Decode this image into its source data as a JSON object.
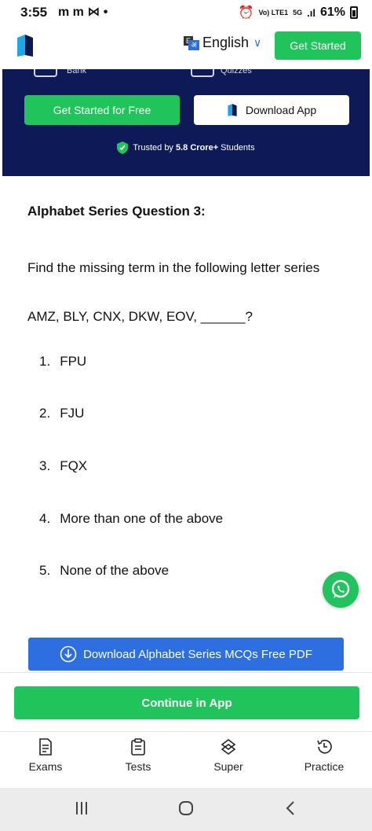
{
  "status_bar": {
    "time": "3:55",
    "notif_icons": [
      "m",
      "m",
      "mail",
      "•"
    ],
    "network": "Vo) LTE1",
    "signal": "5G",
    "battery": "61%"
  },
  "header": {
    "language": "English",
    "get_started": "Get Started"
  },
  "banner": {
    "chip_left": "Bank",
    "chip_right": "Quizzes",
    "get_started_free": "Get Started for Free",
    "download_app": "Download App",
    "trusted_prefix": "Trusted by ",
    "trusted_count": "5.8 Crore+",
    "trusted_suffix": " Students"
  },
  "question": {
    "title": "Alphabet Series Question 3:",
    "text": "Find the missing term in the following letter series",
    "series": "AMZ, BLY, CNX, DKW, EOV, ______?",
    "options": [
      {
        "num": "1.",
        "text": "FPU"
      },
      {
        "num": "2.",
        "text": "FJU"
      },
      {
        "num": "3.",
        "text": "FQX"
      },
      {
        "num": "4.",
        "text": "More than one of the above"
      },
      {
        "num": "5.",
        "text": "None of the above"
      }
    ]
  },
  "pdf_button": "Download Alphabet Series MCQs Free PDF",
  "continue_button": "Continue in App",
  "bottom_nav": {
    "items": [
      "Exams",
      "Tests",
      "Super",
      "Practice"
    ]
  },
  "colors": {
    "green": "#21c45a",
    "navy": "#0d1a57",
    "blue": "#2d6fe0"
  }
}
